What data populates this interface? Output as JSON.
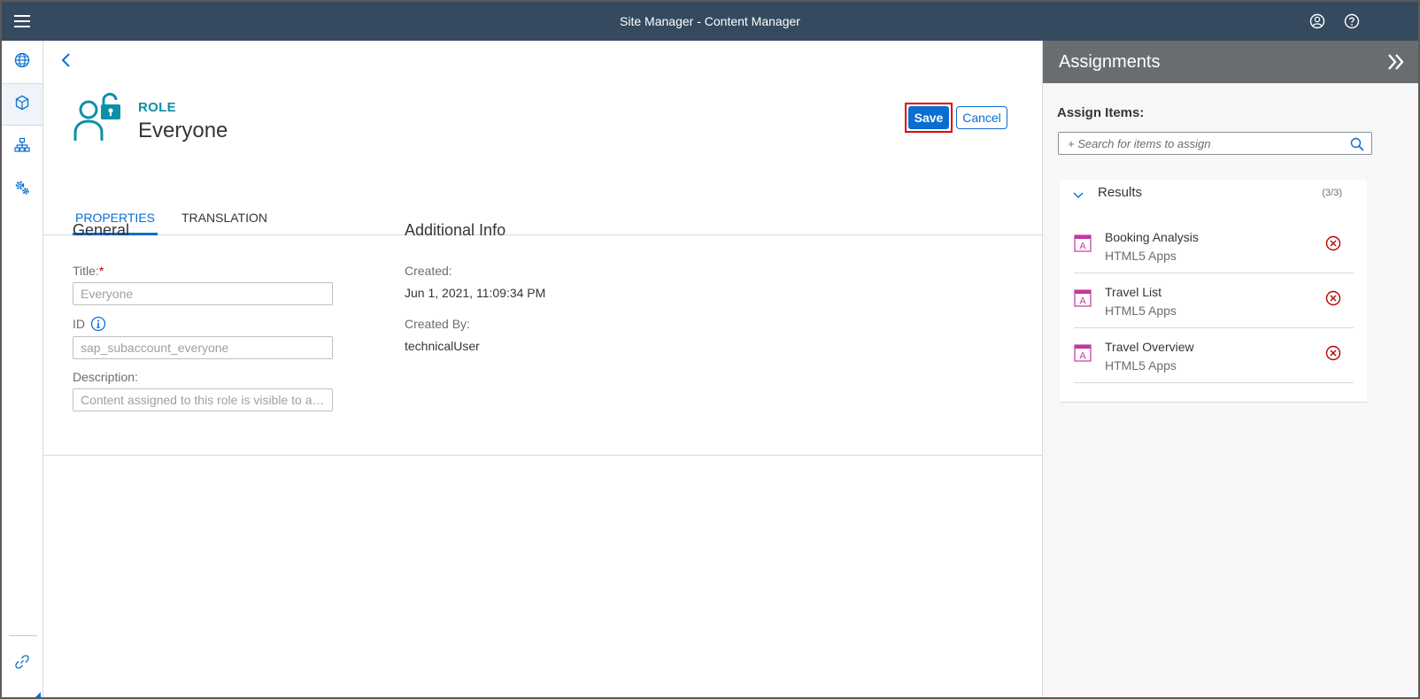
{
  "shell": {
    "title": "Site Manager - Content Manager"
  },
  "icons": {
    "menu": "menu-icon",
    "user": "user-profile-icon",
    "help": "help-icon",
    "globe": "globe-icon",
    "content": "content-cube-icon",
    "hierarchy": "hierarchy-icon",
    "settings": "settings-icon",
    "link": "link-icon"
  },
  "page": {
    "role_type": "ROLE",
    "role_name": "Everyone",
    "save_label": "Save",
    "cancel_label": "Cancel",
    "tabs": [
      {
        "label": "PROPERTIES",
        "active": true
      },
      {
        "label": "TRANSLATION",
        "active": false
      }
    ]
  },
  "general": {
    "heading": "General",
    "title_label": "Title:",
    "title_required": "*",
    "title_value": "Everyone",
    "id_label": "ID",
    "id_value": "sap_subaccount_everyone",
    "description_label": "Description:",
    "description_value": "Content assigned to this role is visible to all users."
  },
  "additional": {
    "heading": "Additional Info",
    "created_label": "Created:",
    "created_value": "Jun 1, 2021, 11:09:34 PM",
    "created_by_label": "Created By:",
    "created_by_value": "technicalUser"
  },
  "assignments": {
    "title": "Assignments",
    "assign_label": "Assign Items:",
    "search_placeholder": "+ Search for items to assign",
    "results_title": "Results",
    "results_count": "(3/3)",
    "items": [
      {
        "title": "Booking Analysis",
        "type": "HTML5 Apps"
      },
      {
        "title": "Travel List",
        "type": "HTML5 Apps"
      },
      {
        "title": "Travel Overview",
        "type": "HTML5 Apps"
      }
    ]
  },
  "colors": {
    "shell": "#354a5f",
    "accent": "#0a6ed1",
    "role_teal": "#0d8fa8",
    "app_icon": "#c0399f",
    "remove": "#bb0000",
    "highlight": "#e00000"
  }
}
